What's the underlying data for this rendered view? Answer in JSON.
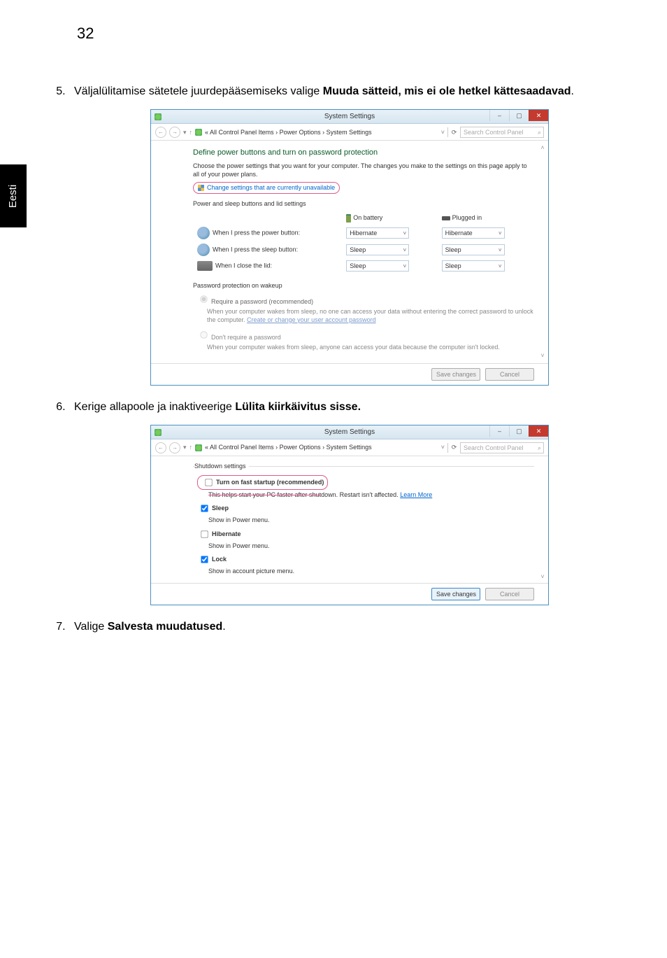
{
  "page_number": "32",
  "side_tab": "Eesti",
  "step5": {
    "prefix": "Väljalülitamise sätetele juurdepääsemiseks valige ",
    "bold": "Muuda sätteid, mis ei ole hetkel kättesaadavad",
    "suffix": "."
  },
  "step6": {
    "prefix": "Kerige allapoole ja inaktiveerige ",
    "bold": "Lülita kiirkäivitus sisse."
  },
  "step7": {
    "prefix": "Valige ",
    "bold": "Salvesta muudatused",
    "suffix": "."
  },
  "win1": {
    "title": "System Settings",
    "breadcrumb": "«  All Control Panel Items  ›  Power Options  ›  System Settings",
    "search_placeholder": "Search Control Panel",
    "heading": "Define power buttons and turn on password protection",
    "intro": "Choose the power settings that you want for your computer. The changes you make to the settings on this page apply to all of your power plans.",
    "change_link": "Change settings that are currently unavailable",
    "section_buttons": "Power and sleep buttons and lid settings",
    "col_battery": "On battery",
    "col_plugged": "Plugged in",
    "rows": [
      {
        "label": "When I press the power button:",
        "battery": "Hibernate",
        "plugged": "Hibernate"
      },
      {
        "label": "When I press the sleep button:",
        "battery": "Sleep",
        "plugged": "Sleep"
      },
      {
        "label": "When I close the lid:",
        "battery": "Sleep",
        "plugged": "Sleep"
      }
    ],
    "section_password": "Password protection on wakeup",
    "radio1_label": "Require a password (recommended)",
    "radio1_desc_a": "When your computer wakes from sleep, no one can access your data without entering the correct password to unlock the computer. ",
    "radio1_desc_link": "Create or change your user account password",
    "radio2_label": "Don't require a password",
    "radio2_desc": "When your computer wakes from sleep, anyone can access your data because the computer isn't locked.",
    "save": "Save changes",
    "cancel": "Cancel"
  },
  "win2": {
    "title": "System Settings",
    "breadcrumb": "«  All Control Panel Items  ›  Power Options  ›  System Settings",
    "search_placeholder": "Search Control Panel",
    "legend": "Shutdown settings",
    "cb1_label": "Turn on fast startup (recommended)",
    "cb1_desc_strike": "This helps start your PC faster after shut",
    "cb1_desc_rest": "down. Restart isn't affected. ",
    "cb1_learn": "Learn More",
    "cb2_label": "Sleep",
    "cb2_desc": "Show in Power menu.",
    "cb3_label": "Hibernate",
    "cb3_desc": "Show in Power menu.",
    "cb4_label": "Lock",
    "cb4_desc": "Show in account picture menu.",
    "save": "Save changes",
    "cancel": "Cancel"
  }
}
